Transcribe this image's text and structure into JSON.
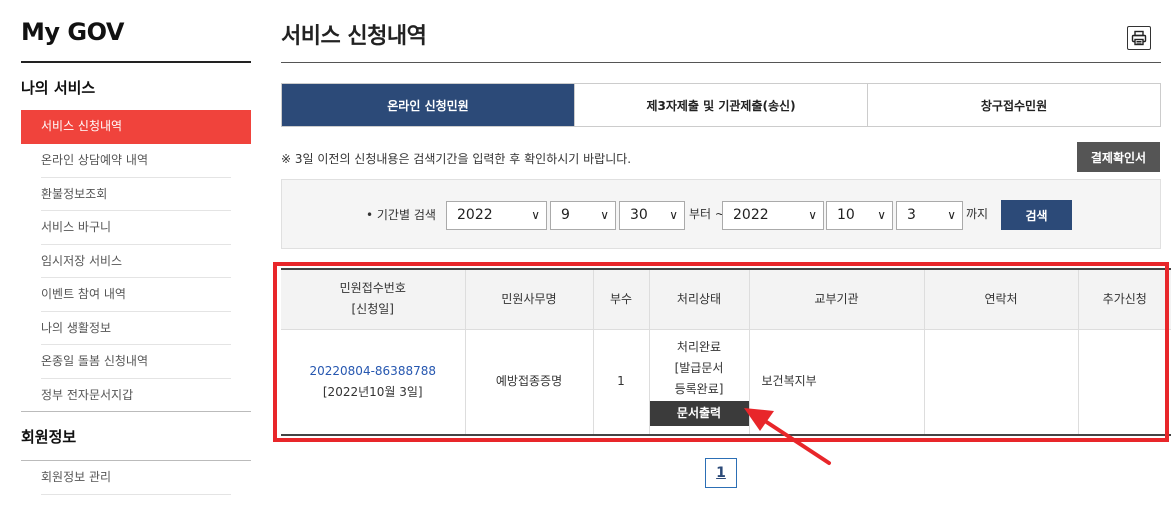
{
  "sidebar": {
    "site_title": "My GOV",
    "section1_heading": "나의 서비스",
    "section1_items": [
      {
        "label": "서비스 신청내역"
      },
      {
        "label": "온라인 상담예약 내역"
      },
      {
        "label": "환불정보조회"
      },
      {
        "label": "서비스 바구니"
      },
      {
        "label": "임시저장 서비스"
      },
      {
        "label": "이벤트 참여 내역"
      },
      {
        "label": "나의 생활정보"
      },
      {
        "label": "온종일 돌봄 신청내역"
      },
      {
        "label": "정부 전자문서지갑"
      }
    ],
    "section2_heading": "회원정보",
    "section2_items": [
      {
        "label": "회원정보 관리"
      }
    ]
  },
  "main": {
    "page_title": "서비스 신청내역",
    "tabs": [
      {
        "label": "온라인 신청민원",
        "active": true
      },
      {
        "label": "제3자제출 및 기관제출(송신)",
        "active": false
      },
      {
        "label": "창구접수민원",
        "active": false
      }
    ],
    "notice": "※ 3일 이전의 신청내용은 검색기간을 입력한 후 확인하시기 바랍니다.",
    "payment_button": "결제확인서",
    "search": {
      "label": "• 기간별 검색",
      "from_year": "2022",
      "from_month": "9",
      "from_day": "30",
      "from_suffix": "부터 ~",
      "to_year": "2022",
      "to_month": "10",
      "to_day": "3",
      "to_suffix": "까지",
      "button": "검색"
    },
    "table": {
      "headers": {
        "col1_line1": "민원접수번호",
        "col1_line2": "[신청일]",
        "col2": "민원사무명",
        "col3": "부수",
        "col4": "처리상태",
        "col5": "교부기관",
        "col6": "연락처",
        "col7": "추가신청"
      },
      "rows": [
        {
          "receipt_no": "20220804-86388788",
          "apply_date": "[2022년10월 3일]",
          "service_name": "예방접종증명",
          "copies": "1",
          "status_line1": "처리완료",
          "status_line2": "[발급문서",
          "status_line3": "등록완료]",
          "print_button": "문서출력",
          "issuing_agency": "보건복지부",
          "contact": "",
          "additional": ""
        }
      ]
    },
    "pagination": {
      "current_page": "1"
    },
    "colors": {
      "accent_red": "#f0433c",
      "navy": "#2c4a78",
      "highlight": "#e8262a"
    }
  }
}
